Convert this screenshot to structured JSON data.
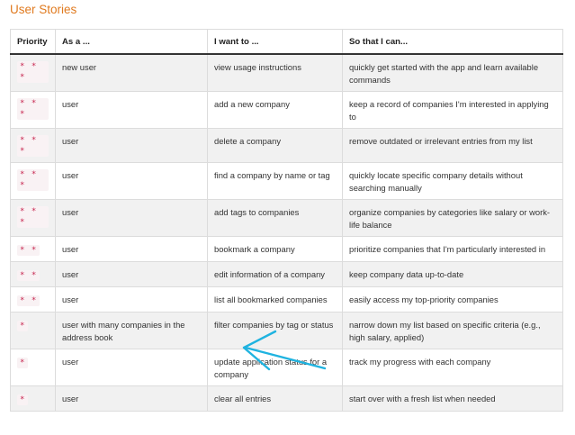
{
  "heading": "User Stories",
  "table": {
    "headers": [
      "Priority",
      "As a ...",
      "I want to ...",
      "So that I can..."
    ],
    "rows": [
      {
        "priority": "* * *",
        "as_a": "new user",
        "want": "view usage instructions",
        "so_that": "quickly get started with the app and learn available commands"
      },
      {
        "priority": "* * *",
        "as_a": "user",
        "want": "add a new company",
        "so_that": "keep a record of companies I'm interested in applying to"
      },
      {
        "priority": "* * *",
        "as_a": "user",
        "want": "delete a company",
        "so_that": "remove outdated or irrelevant entries from my list"
      },
      {
        "priority": "* * *",
        "as_a": "user",
        "want": "find a company by name or tag",
        "so_that": "quickly locate specific company details without searching manually"
      },
      {
        "priority": "* * *",
        "as_a": "user",
        "want": "add tags to companies",
        "so_that": "organize companies by categories like salary or work-life balance"
      },
      {
        "priority": "* *",
        "as_a": "user",
        "want": "bookmark a company",
        "so_that": "prioritize companies that I'm particularly interested in"
      },
      {
        "priority": "* *",
        "as_a": "user",
        "want": "edit information of a company",
        "so_that": "keep company data up-to-date"
      },
      {
        "priority": "* *",
        "as_a": "user",
        "want": "list all bookmarked companies",
        "so_that": "easily access my top-priority companies"
      },
      {
        "priority": "*",
        "as_a": "user with many companies in the address book",
        "want": "filter companies by tag or status",
        "so_that": "narrow down my list based on specific criteria (e.g., high salary, applied)"
      },
      {
        "priority": "*",
        "as_a": "user",
        "want": "update application status for a company",
        "so_that": "track my progress with each company"
      },
      {
        "priority": "*",
        "as_a": "user",
        "want": "clear all entries",
        "so_that": "start over with a fresh list when needed"
      }
    ]
  },
  "colors": {
    "heading": "#e07a1f",
    "priority_text": "#c7254e",
    "annotation_arrow": "#1fb3e0"
  }
}
